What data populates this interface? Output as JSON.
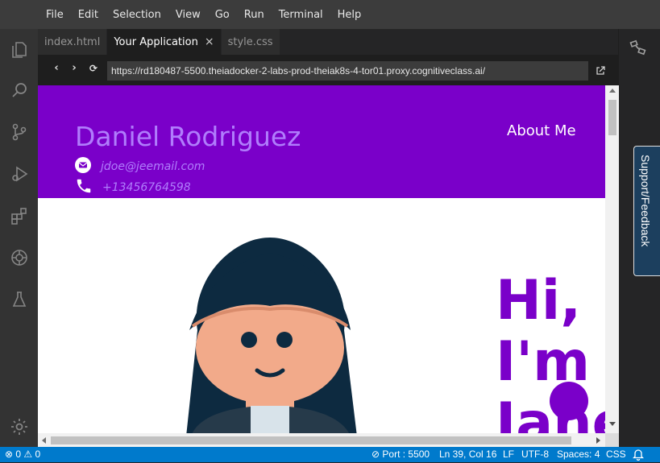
{
  "menu": [
    "File",
    "Edit",
    "Selection",
    "View",
    "Go",
    "Run",
    "Terminal",
    "Help"
  ],
  "tabs": [
    {
      "label": "index.html",
      "active": false
    },
    {
      "label": "Your Application",
      "active": true
    },
    {
      "label": "style.css",
      "active": false
    }
  ],
  "tab_close_glyph": "×",
  "nav": {
    "back": "‹",
    "forward": "›",
    "refresh": "⟳",
    "url": "https://rd180487-5500.theiadocker-2-labs-prod-theiak8s-4-tor01.proxy.cognitiveclass.ai/"
  },
  "page": {
    "name": "Daniel Rodriguez",
    "email": "jdoe@jeemail.com",
    "phone": "+13456764598",
    "about": "About Me",
    "hero_lines": [
      "Hi,",
      "I'm",
      "Jane"
    ]
  },
  "support_label": "Support/Feedback",
  "status": {
    "problems": "⊗ 0 ⚠ 0",
    "port": "⊘ Port : 5500",
    "position": "Ln 39, Col 16",
    "eol": "LF",
    "encoding": "UTF-8",
    "spaces": "Spaces: 4",
    "language": "CSS"
  },
  "colors": {
    "accent": "#7a00c9",
    "name": "#b07dfc",
    "statusbar": "#007acc"
  }
}
